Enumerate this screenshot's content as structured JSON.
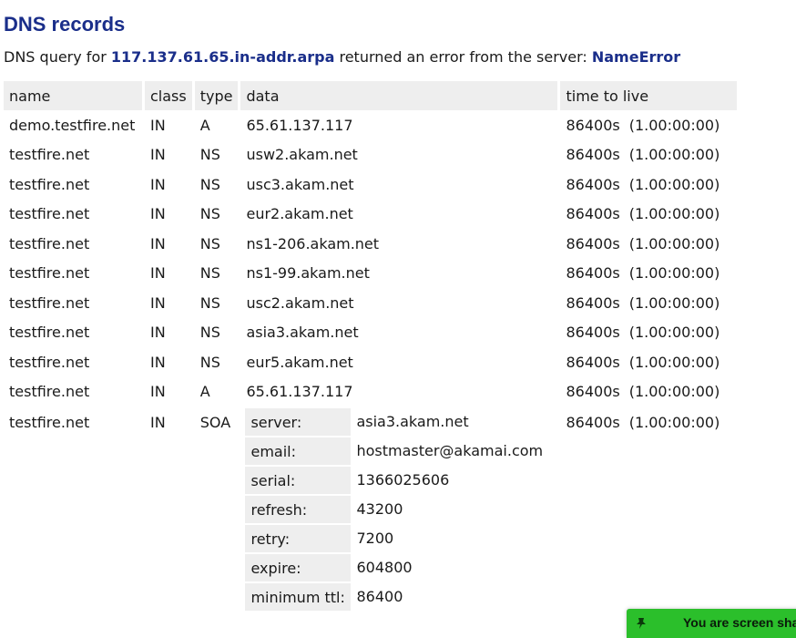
{
  "heading": "DNS records",
  "summary": {
    "prefix": "DNS query for",
    "query": "117.137.61.65.in-addr.arpa",
    "middle": "returned an error from the server:",
    "error": "NameError"
  },
  "table": {
    "headers": [
      "name",
      "class",
      "type",
      "data",
      "time to live"
    ],
    "rows": [
      {
        "name": "demo.testfire.net",
        "class": "IN",
        "type": "A",
        "data": "65.61.137.117",
        "ttl": "86400s",
        "ttl_human": "(1.00:00:00)"
      },
      {
        "name": "testfire.net",
        "class": "IN",
        "type": "NS",
        "data": "usw2.akam.net",
        "ttl": "86400s",
        "ttl_human": "(1.00:00:00)"
      },
      {
        "name": "testfire.net",
        "class": "IN",
        "type": "NS",
        "data": "usc3.akam.net",
        "ttl": "86400s",
        "ttl_human": "(1.00:00:00)"
      },
      {
        "name": "testfire.net",
        "class": "IN",
        "type": "NS",
        "data": "eur2.akam.net",
        "ttl": "86400s",
        "ttl_human": "(1.00:00:00)"
      },
      {
        "name": "testfire.net",
        "class": "IN",
        "type": "NS",
        "data": "ns1-206.akam.net",
        "ttl": "86400s",
        "ttl_human": "(1.00:00:00)"
      },
      {
        "name": "testfire.net",
        "class": "IN",
        "type": "NS",
        "data": "ns1-99.akam.net",
        "ttl": "86400s",
        "ttl_human": "(1.00:00:00)"
      },
      {
        "name": "testfire.net",
        "class": "IN",
        "type": "NS",
        "data": "usc2.akam.net",
        "ttl": "86400s",
        "ttl_human": "(1.00:00:00)"
      },
      {
        "name": "testfire.net",
        "class": "IN",
        "type": "NS",
        "data": "asia3.akam.net",
        "ttl": "86400s",
        "ttl_human": "(1.00:00:00)"
      },
      {
        "name": "testfire.net",
        "class": "IN",
        "type": "NS",
        "data": "eur5.akam.net",
        "ttl": "86400s",
        "ttl_human": "(1.00:00:00)"
      },
      {
        "name": "testfire.net",
        "class": "IN",
        "type": "A",
        "data": "65.61.137.117",
        "ttl": "86400s",
        "ttl_human": "(1.00:00:00)"
      }
    ],
    "soa_row": {
      "name": "testfire.net",
      "class": "IN",
      "type": "SOA",
      "ttl": "86400s",
      "ttl_human": "(1.00:00:00)",
      "fields": [
        {
          "key": "server:",
          "value": "asia3.akam.net"
        },
        {
          "key": "email:",
          "value": "hostmaster@akamai.com"
        },
        {
          "key": "serial:",
          "value": "1366025606"
        },
        {
          "key": "refresh:",
          "value": "43200"
        },
        {
          "key": "retry:",
          "value": "7200"
        },
        {
          "key": "expire:",
          "value": "604800"
        },
        {
          "key": "minimum ttl:",
          "value": "86400"
        }
      ]
    }
  },
  "toast": {
    "message": "You are screen sha",
    "icon": "pin-icon",
    "color": "#2bbf2b"
  },
  "colors": {
    "heading": "#1a2e8a",
    "header_bg": "#eeeeee"
  }
}
